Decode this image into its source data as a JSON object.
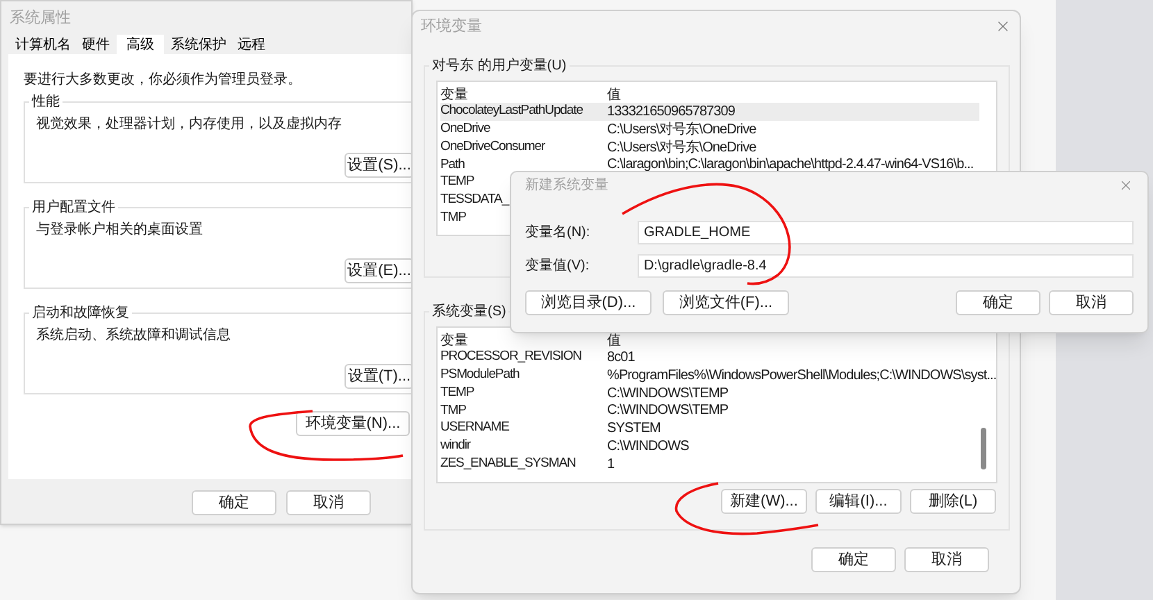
{
  "system_properties": {
    "title": "系统属性",
    "tabs": [
      {
        "label": "计算机名",
        "selected": false
      },
      {
        "label": "硬件",
        "selected": false
      },
      {
        "label": "高级",
        "selected": true
      },
      {
        "label": "系统保护",
        "selected": false
      },
      {
        "label": "远程",
        "selected": false
      }
    ],
    "notice": "要进行大多数更改，你必须作为管理员登录。",
    "groups": [
      {
        "title": "性能",
        "description": "视觉效果，处理器计划，内存使用，以及虚拟内存",
        "button": "设置(S)..."
      },
      {
        "title": "用户配置文件",
        "description": "与登录帐户相关的桌面设置",
        "button": "设置(E)..."
      },
      {
        "title": "启动和故障恢复",
        "description": "系统启动、系统故障和调试信息",
        "button": "设置(T)..."
      }
    ],
    "env_button": "环境变量(N)...",
    "buttons": [
      "确定",
      "取消"
    ]
  },
  "environment_variables": {
    "title": "环境变量",
    "user_group": {
      "title": "对号东 的用户变量(U)",
      "columns": [
        "变量",
        "值"
      ],
      "rows": [
        {
          "name": "ChocolateyLastPathUpdate",
          "value": "133321650965787309",
          "selected": true
        },
        {
          "name": "OneDrive",
          "value": "C:\\Users\\对号东\\OneDrive",
          "selected": false
        },
        {
          "name": "OneDriveConsumer",
          "value": "C:\\Users\\对号东\\OneDrive",
          "selected": false
        },
        {
          "name": "Path",
          "value": "C:\\laragon\\bin;C:\\laragon\\bin\\apache\\httpd-2.4.47-win64-VS16\\b...",
          "selected": false
        },
        {
          "name": "TEMP",
          "selected": false
        },
        {
          "name": "TESSDATA_",
          "selected": false
        },
        {
          "name": "TMP",
          "selected": false
        }
      ]
    },
    "system_group": {
      "title": "系统变量(S)",
      "columns": [
        "变量",
        "值"
      ],
      "rows": [
        {
          "name": "PROCESSOR_REVISION",
          "value": "8c01",
          "selected": false
        },
        {
          "name": "PSModulePath",
          "value": "%ProgramFiles%\\WindowsPowerShell\\Modules;C:\\WINDOWS\\syst...",
          "selected": false
        },
        {
          "name": "TEMP",
          "value": "C:\\WINDOWS\\TEMP",
          "selected": false
        },
        {
          "name": "TMP",
          "value": "C:\\WINDOWS\\TEMP",
          "selected": false
        },
        {
          "name": "USERNAME",
          "value": "SYSTEM",
          "selected": false
        },
        {
          "name": "windir",
          "value": "C:\\WINDOWS",
          "selected": false
        },
        {
          "name": "ZES_ENABLE_SYSMAN",
          "value": "1",
          "selected": false
        }
      ],
      "buttons": [
        "新建(W)...",
        "编辑(I)...",
        "删除(L)"
      ]
    },
    "buttons": [
      "确定",
      "取消"
    ]
  },
  "new_variable": {
    "title": "新建系统变量",
    "fields": [
      {
        "label": "变量名(N):",
        "value": "GRADLE_HOME"
      },
      {
        "label": "变量值(V):",
        "value": "D:\\gradle\\gradle-8.4"
      }
    ],
    "browse_buttons": [
      "浏览目录(D)...",
      "浏览文件(F)..."
    ],
    "buttons": [
      "确定",
      "取消"
    ]
  }
}
